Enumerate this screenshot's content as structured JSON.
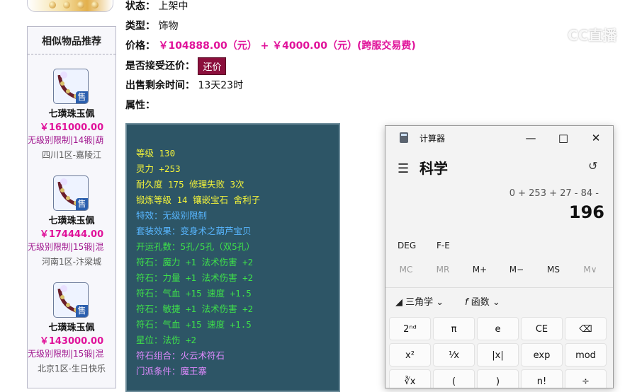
{
  "item": {
    "status_label": "状态：",
    "status_value": "上架中",
    "type_label": "类型：",
    "type_value": "饰物",
    "price_label": "价格：",
    "price_value": "￥104888.00（元） + ￥4000.00（元）(跨服交易费)",
    "bargain_label": "是否接受还价：",
    "bargain_button": "还价",
    "remaining_label": "出售剩余时间：",
    "remaining_value": "13天23时",
    "attrs_label": "属性："
  },
  "similar": {
    "title": "相似物品推荐",
    "items": [
      {
        "name": "七璜珠玉佩",
        "price": "￥161000.00",
        "tags": "无级别限制|14锻|葫",
        "server": "四川1区-嘉陵江",
        "badge": "售"
      },
      {
        "name": "七璜珠玉佩",
        "price": "￥174444.00",
        "tags": "无级别限制|15锻|混",
        "server": "河南1区-汴梁城",
        "badge": "售"
      },
      {
        "name": "七璜珠玉佩",
        "price": "￥143000.00",
        "tags": "无级别限制|15锻|混",
        "server": "北京1区-生日快乐",
        "badge": "售"
      }
    ]
  },
  "attributes": [
    {
      "text": "等级 130",
      "color": "#f2f23a"
    },
    {
      "text": "灵力 +253",
      "color": "#f2f23a"
    },
    {
      "text": "耐久度 175 修理失败 3次",
      "color": "#f2f23a"
    },
    {
      "text": "锻炼等级 14 镶嵌宝石 舍利子",
      "color": "#f2f23a"
    },
    {
      "text": "特效：无级别限制",
      "color": "#58b6ff"
    },
    {
      "text": "套装效果：变身术之葫芦宝贝",
      "color": "#58b6ff"
    },
    {
      "text": "开运孔数：5孔/5孔（双5孔）",
      "color": "#3ee04a"
    },
    {
      "text": "符石：魔力 +1 法术伤害 +2",
      "color": "#3ee04a"
    },
    {
      "text": "符石：力量 +1 法术伤害 +2",
      "color": "#3ee04a"
    },
    {
      "text": "符石：气血 +15 速度 +1.5",
      "color": "#3ee04a"
    },
    {
      "text": "符石：敏捷 +1 法术伤害 +2",
      "color": "#3ee04a"
    },
    {
      "text": "符石：气血 +15 速度 +1.5",
      "color": "#3ee04a"
    },
    {
      "text": "星位：法伤 +2",
      "color": "#3ee04a"
    },
    {
      "text": "符石组合：火云术符石",
      "color": "#e08aff"
    },
    {
      "text": "门派条件：魔王寨",
      "color": "#e08aff"
    }
  ],
  "watermark": "CC直播",
  "calculator": {
    "title": "计算器",
    "mode": "科学",
    "expression": "0 + 253 + 27 - 84 -",
    "result": "196",
    "angle_mode": "DEG",
    "fe": "F-E",
    "memory": [
      "MC",
      "MR",
      "M+",
      "M−",
      "MS",
      "M∨"
    ],
    "trig_label": "三角学",
    "func_label": "函数",
    "keys_row1": [
      "2ⁿᵈ",
      "π",
      "e",
      "CE",
      "⌫"
    ],
    "keys_row2": [
      "x²",
      "¹⁄x",
      "|x|",
      "exp",
      "mod"
    ],
    "keys_row3": [
      "∛x",
      "(",
      ")",
      "n!",
      "÷"
    ],
    "colors": {
      "attr_bg": "#2d5566",
      "price": "#e0129a",
      "button": "#8b0f3c"
    }
  }
}
